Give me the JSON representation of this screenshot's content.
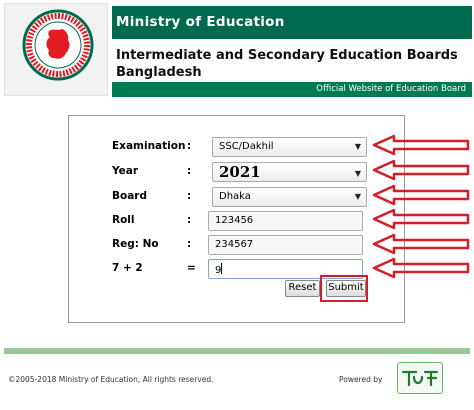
{
  "header": {
    "ministry": "Ministry of Education",
    "board_line1": "Intermediate and Secondary Education Boards",
    "board_line2": "Bangladesh",
    "official": "Official Website of Education Board"
  },
  "form": {
    "examination": {
      "label": "Examination",
      "value": "SSC/Dakhil"
    },
    "year": {
      "label": "Year",
      "value": "2021"
    },
    "board": {
      "label": "Board",
      "value": "Dhaka"
    },
    "roll": {
      "label": "Roll",
      "value": "123456"
    },
    "reg": {
      "label": "Reg: No",
      "value": "234567"
    },
    "captcha": {
      "label": "7 + 2",
      "value": "9"
    },
    "colon": ":",
    "equals": "=",
    "reset_label": "Reset",
    "submit_label": "Submit"
  },
  "footer": {
    "copyright": "©2005-2018 Ministry of Education, All rights reserved.",
    "powered": "Powered by"
  },
  "colors": {
    "brand_green": "#006a4e",
    "annotation_red": "#d21f2a",
    "seal_red": "#e31b23"
  }
}
